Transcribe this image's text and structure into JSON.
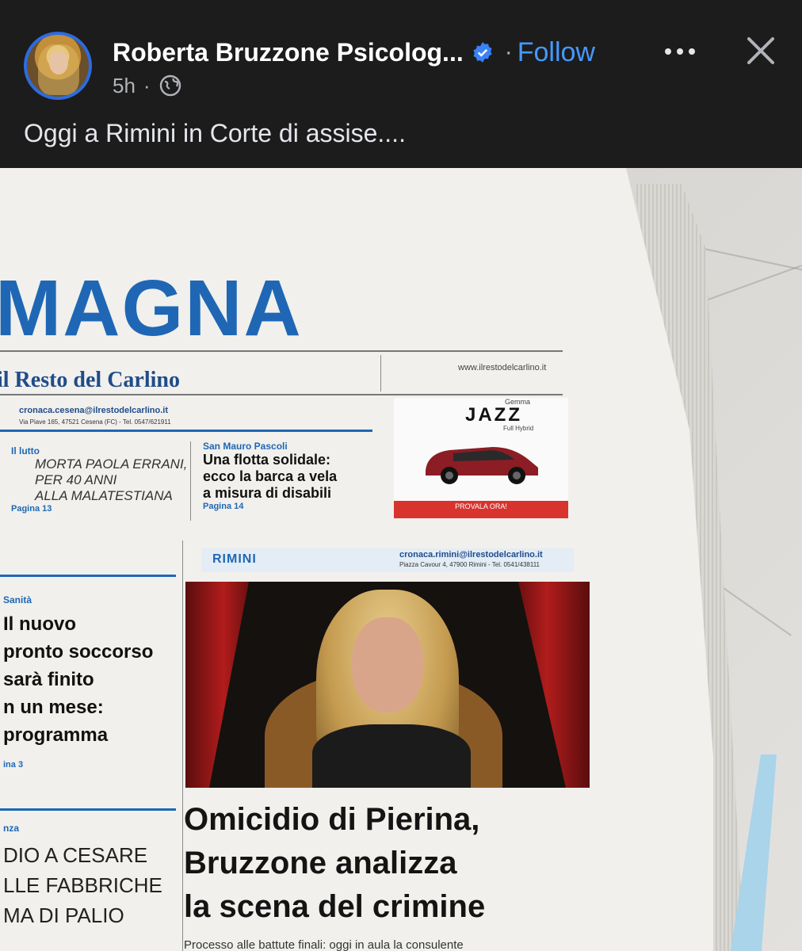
{
  "post": {
    "author": "Roberta Bruzzone Psicolog...",
    "separator": "·",
    "follow_label": "Follow",
    "timestamp": "5h",
    "meta_separator": "·",
    "caption": "Oggi a Rimini in Corte di assise....",
    "accent_color": "#4599ff"
  },
  "icons": {
    "avatar": "avatar",
    "verified": "verified-badge-icon",
    "more": "more-options-icon",
    "close": "close-icon",
    "audience": "globe-icon"
  },
  "newspaper": {
    "masthead": "MAGNA",
    "paper_name": "il Resto del Carlino",
    "url": "www.ilrestodelcarlino.it",
    "cesena_email": "cronaca.cesena@ilrestodelcarlino.it",
    "cesena_address": "Via Piave 165, 47521 Cesena (FC) - Tel. 0547/621911",
    "story_lutto": {
      "kicker": "Il lutto",
      "lines": [
        "MORTA PAOLA ERRANI,",
        "PER 40 ANNI",
        "ALLA MALATESTIANA"
      ],
      "page": "Pagina 13"
    },
    "story_sanmauro": {
      "kicker": "San Mauro Pascoli",
      "lines": [
        "Una flotta solidale:",
        "ecco la barca a vela",
        "a misura di disabili"
      ],
      "page": "Pagina 14"
    },
    "ad": {
      "small": "Gemma",
      "brand": "JAZZ",
      "sub": "Full Hybrid",
      "cta": "PROVALA ORA!"
    },
    "story_sanita": {
      "kicker": "Sanità",
      "lines": [
        "Il nuovo",
        "pronto soccorso",
        "sarà finito",
        "n un mese:",
        "programma"
      ],
      "page": "ina 3"
    },
    "story_bottom": {
      "kicker": "nza",
      "lines": [
        "DIO A CESARE",
        "LLE FABBRICHE",
        "MA DI PALIO"
      ]
    },
    "rimini": {
      "label": "RIMINI",
      "email": "cronaca.rimini@ilrestodelcarlino.it",
      "address": "Piazza Cavour 4, 47900 Rimini - Tel. 0541/438111"
    },
    "headline": [
      "Omicidio di Pierina,",
      "Bruzzone analizza",
      "la scena del crimine"
    ],
    "subline": "Processo alle battute finali: oggi in aula la consulente"
  }
}
